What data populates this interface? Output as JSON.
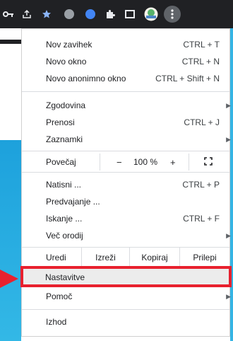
{
  "menu": {
    "new_tab": {
      "label": "Nov zavihek",
      "shortcut": "CTRL + T"
    },
    "new_window": {
      "label": "Novo okno",
      "shortcut": "CTRL + N"
    },
    "incognito": {
      "label": "Novo anonimno okno",
      "shortcut": "CTRL + Shift + N"
    },
    "history": {
      "label": "Zgodovina"
    },
    "downloads": {
      "label": "Prenosi",
      "shortcut": "CTRL + J"
    },
    "bookmarks": {
      "label": "Zaznamki"
    },
    "zoom": {
      "label": "Povečaj",
      "minus": "−",
      "value": "100 %",
      "plus": "+",
      "fullscreen": "⛶"
    },
    "print": {
      "label": "Natisni ...",
      "shortcut": "CTRL + P"
    },
    "cast": {
      "label": "Predvajanje ..."
    },
    "find": {
      "label": "Iskanje ...",
      "shortcut": "CTRL + F"
    },
    "more_tools": {
      "label": "Več orodij"
    },
    "edit": {
      "label": "Uredi",
      "cut": "Izreži",
      "copy": "Kopiraj",
      "paste": "Prilepi"
    },
    "settings": {
      "label": "Nastavitve"
    },
    "help": {
      "label": "Pomoč"
    },
    "exit": {
      "label": "Izhod"
    }
  },
  "colors": {
    "highlight": "#e8212e",
    "toolbar": "#202124"
  }
}
